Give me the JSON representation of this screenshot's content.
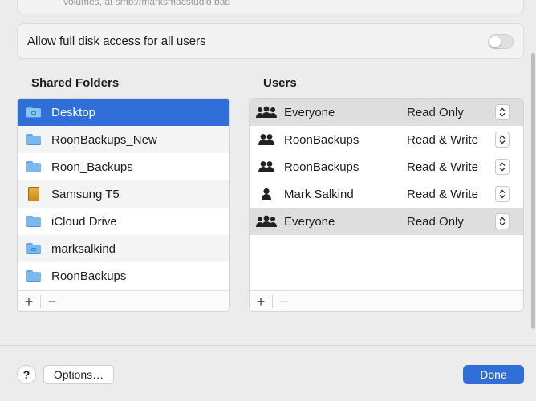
{
  "header": {
    "path_text": "volumes, at smb://marksmacstudio.bad"
  },
  "access": {
    "label": "Allow full disk access for all users",
    "enabled": false
  },
  "shared_folders": {
    "title": "Shared Folders",
    "items": [
      {
        "label": "Desktop",
        "icon": "folder-icon",
        "selected": true
      },
      {
        "label": "RoonBackups_New",
        "icon": "folder-icon"
      },
      {
        "label": "Roon_Backups",
        "icon": "folder-icon"
      },
      {
        "label": "Samsung T5",
        "icon": "external-drive-icon"
      },
      {
        "label": "iCloud Drive",
        "icon": "folder-icon"
      },
      {
        "label": "marksalkind",
        "icon": "home-folder-icon"
      },
      {
        "label": "RoonBackups",
        "icon": "folder-icon"
      }
    ],
    "add_label": "+",
    "remove_label": "−"
  },
  "users": {
    "title": "Users",
    "items": [
      {
        "name": "Everyone",
        "permission": "Read Only",
        "icon": "group-everyone-icon"
      },
      {
        "name": "RoonBackups",
        "permission": "Read & Write",
        "icon": "group-icon"
      },
      {
        "name": "RoonBackups",
        "permission": "Read & Write",
        "icon": "group-icon"
      },
      {
        "name": "Mark Salkind",
        "permission": "Read & Write",
        "icon": "user-icon"
      },
      {
        "name": "Everyone",
        "permission": "Read Only",
        "icon": "group-everyone-icon"
      }
    ],
    "add_label": "+",
    "remove_label": "−"
  },
  "footer": {
    "help_label": "?",
    "options_label": "Options…",
    "done_label": "Done"
  },
  "colors": {
    "accent": "#2f6fd7",
    "background": "#ececec"
  }
}
